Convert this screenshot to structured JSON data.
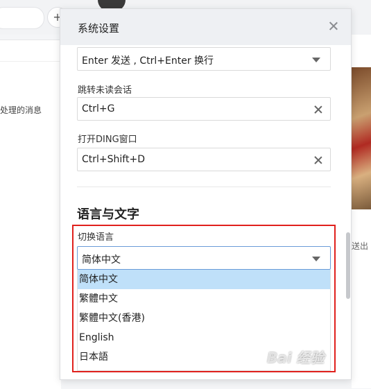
{
  "background": {
    "plus_icon": "+",
    "left_panel_text": "处理的消息",
    "right_panel_text": "送出"
  },
  "dialog": {
    "title": "系统设置",
    "send_shortcut": {
      "value": "Enter 发送 , Ctrl+Enter 换行"
    },
    "unread_jump": {
      "label": "跳转未读会话",
      "value": "Ctrl+G"
    },
    "open_ding": {
      "label": "打开DING窗口",
      "value": "Ctrl+Shift+D"
    },
    "language_section": {
      "title": "语言与文字",
      "switch_label": "切换语言",
      "selected": "简体中文",
      "options": [
        "简体中文",
        "繁體中文",
        "繁體中文(香港)",
        "English",
        "日本語"
      ]
    }
  },
  "watermark": "Bai 经验",
  "colors": {
    "highlight": "#e0201c",
    "selected_option": "#bfe0f9",
    "header_bg": "#eef0f3"
  }
}
